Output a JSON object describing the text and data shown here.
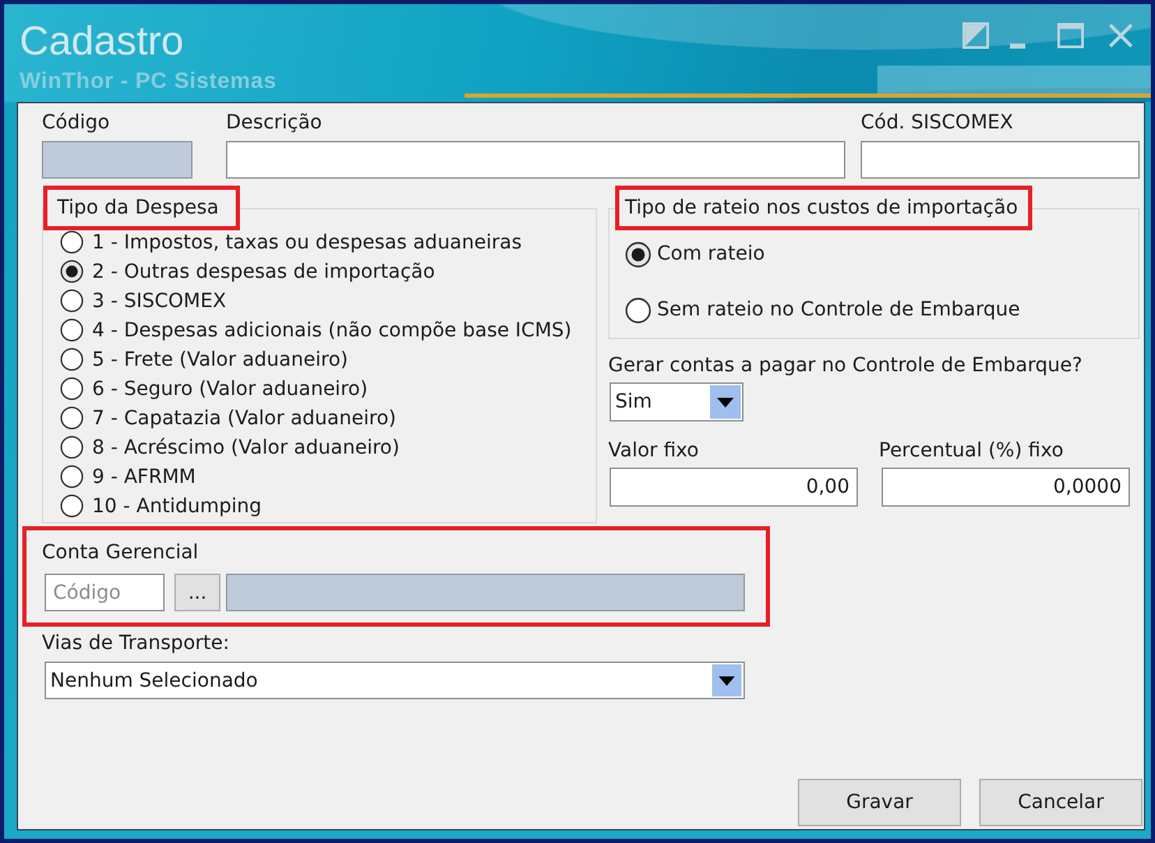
{
  "window": {
    "title": "Cadastro",
    "subtitle": "WinThor - PC Sistemas"
  },
  "fields": [
    {
      "label": "Código",
      "disabled": true
    },
    {
      "label": "Descrição",
      "disabled": false
    },
    {
      "label": "Cód. SISCOMEX",
      "disabled": false
    }
  ],
  "expense_type": {
    "title": "Tipo da Despesa",
    "highlighted": true,
    "options": [
      {
        "label": "1 - Impostos, taxas ou despesas aduaneiras",
        "selected": false
      },
      {
        "label": "2 - Outras despesas de importação",
        "selected": true
      },
      {
        "label": "3 - SISCOMEX",
        "selected": false
      },
      {
        "label": "4 - Despesas adicionais (não compõe base ICMS)",
        "selected": false
      },
      {
        "label": "5 - Frete (Valor aduaneiro)",
        "selected": false
      },
      {
        "label": "6 - Seguro (Valor aduaneiro)",
        "selected": false
      },
      {
        "label": "7 - Capatazia (Valor aduaneiro)",
        "selected": false
      },
      {
        "label": "8 - Acréscimo (Valor aduaneiro)",
        "selected": false
      },
      {
        "label": "9 - AFRMM",
        "selected": false
      },
      {
        "label": "10 - Antidumping",
        "selected": false
      }
    ]
  },
  "allocation_type": {
    "title": "Tipo de rateio nos custos de importação",
    "highlighted": true,
    "options": [
      {
        "label": "Com rateio",
        "selected": true
      },
      {
        "label": "Sem rateio no Controle de Embarque",
        "selected": false
      }
    ]
  },
  "payables": {
    "label": "Gerar contas a pagar no Controle de Embarque?",
    "value": "Sim"
  },
  "fixed_value": {
    "label": "Valor fixo",
    "value": "0,00"
  },
  "fixed_percent": {
    "label": "Percentual (%) fixo",
    "value": "0,0000"
  },
  "management_account": {
    "title": "Conta Gerencial",
    "highlighted": true,
    "code": {
      "placeholder": "Código"
    },
    "lookup_button": "...",
    "name_field": {
      "disabled": true
    }
  },
  "transport": {
    "label": "Vias de Transporte:",
    "value": "Nenhum Selecionado"
  },
  "buttons": [
    "Gravar",
    "Cancelar"
  ]
}
